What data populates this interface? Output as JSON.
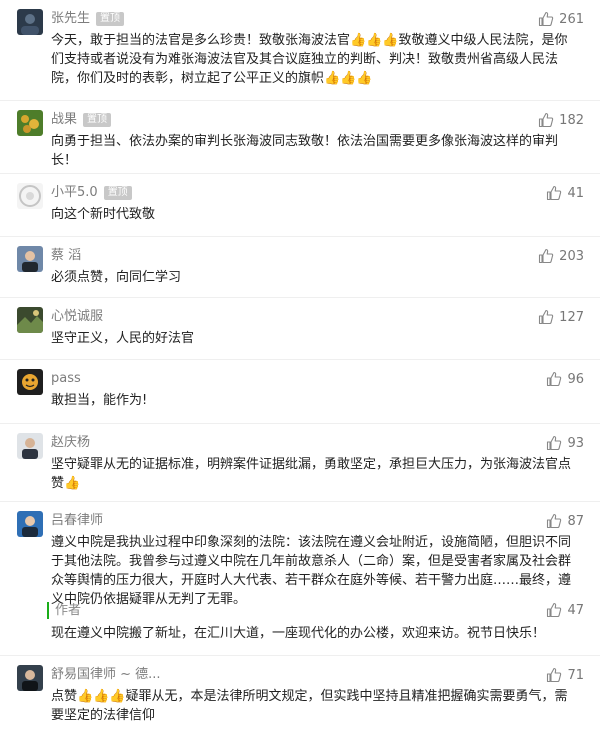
{
  "pinned_label": "置顶",
  "comments": [
    {
      "name": "张先生",
      "pinned": true,
      "likes": "261",
      "text": "今天，敢于担当的法官是多么珍贵！致敬张海波法官👍👍👍致敬遵义中级人民法院，是你们支持或者说没有为难张海波法官及其合议庭独立的判断、判决！致敬贵州省高级人民法院，你们及时的表彰，树立起了公平正义的旗帜👍👍👍"
    },
    {
      "name": "战果",
      "pinned": true,
      "likes": "182",
      "text": "向勇于担当、依法办案的审判长张海波同志致敬！依法治国需要更多像张海波这样的审判长！"
    },
    {
      "name": "小平5.0",
      "pinned": true,
      "likes": "41",
      "text": "向这个新时代致敬"
    },
    {
      "name": "蔡 滔",
      "pinned": false,
      "likes": "203",
      "text": "必须点赞，向同仁学习"
    },
    {
      "name": "心悦诚服",
      "pinned": false,
      "likes": "127",
      "text": "坚守正义，人民的好法官"
    },
    {
      "name": "pass",
      "pinned": false,
      "likes": "96",
      "text": "敢担当，能作为!"
    },
    {
      "name": "赵庆杨",
      "pinned": false,
      "likes": "93",
      "text": "坚守疑罪从无的证据标准，明辨案件证据纰漏，勇敢坚定，承担巨大压力，为张海波法官点赞👍"
    },
    {
      "name": "吕春律师",
      "pinned": false,
      "likes": "87",
      "text": "遵义中院是我执业过程中印象深刻的法院：该法院在遵义会址附近，设施简陋，但胆识不同于其他法院。我曾参与过遵义中院在几年前故意杀人（二命）案，但是受害者家属及社会群众等舆情的压力很大，开庭时人大代表、若干群众在庭外等候、若干警力出庭……最终，遵义中院仍依据疑罪从无判了无罪。"
    },
    {
      "name": "舒易国律师 ~ 德...",
      "pinned": false,
      "likes": "71",
      "text": "点赞👍👍👍疑罪从无，本是法律所明文规定，但实践中坚持且精准把握确实需要勇气，需要坚定的法律信仰"
    }
  ],
  "author_reply": {
    "label": "作者",
    "likes": "47",
    "text": "现在遵义中院搬了新址，在汇川大道，一座现代化的办公楼，欢迎来访。祝节日快乐！"
  }
}
